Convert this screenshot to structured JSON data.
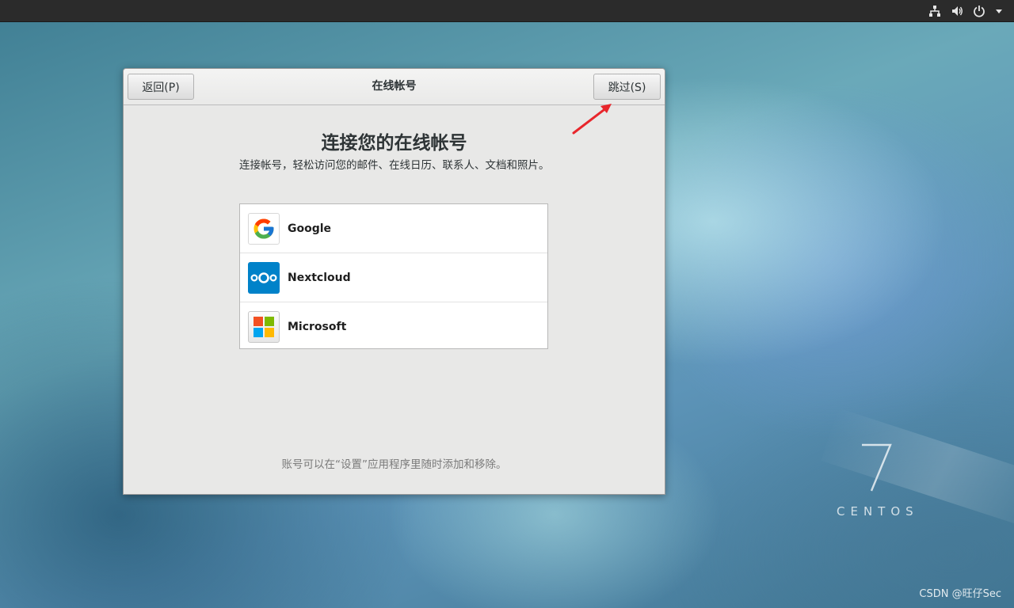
{
  "dialog": {
    "back_label": "返回(P)",
    "title": "在线帐号",
    "skip_label": "跳过(S)",
    "heading": "连接您的在线帐号",
    "description": "连接帐号，轻松访问您的邮件、在线日历、联系人、文档和照片。",
    "providers": [
      {
        "label": "Google",
        "icon": "google-icon"
      },
      {
        "label": "Nextcloud",
        "icon": "nextcloud-icon"
      },
      {
        "label": "Microsoft",
        "icon": "microsoft-icon"
      }
    ],
    "footer": "账号可以在“设置”应用程序里随时添加和移除。"
  },
  "topbar": {
    "icons": [
      "network-icon",
      "volume-icon",
      "power-icon",
      "menu-arrow-icon"
    ]
  },
  "desktop": {
    "logo_number": "7",
    "logo_text": "CENTOS",
    "watermark": "CSDN @旺仔Sec"
  },
  "colors": {
    "arrow": "#e8262c",
    "nextcloud": "#0082c9",
    "ms_red": "#f25022",
    "ms_green": "#7fba00",
    "ms_blue": "#00a4ef",
    "ms_yellow": "#ffb900"
  }
}
